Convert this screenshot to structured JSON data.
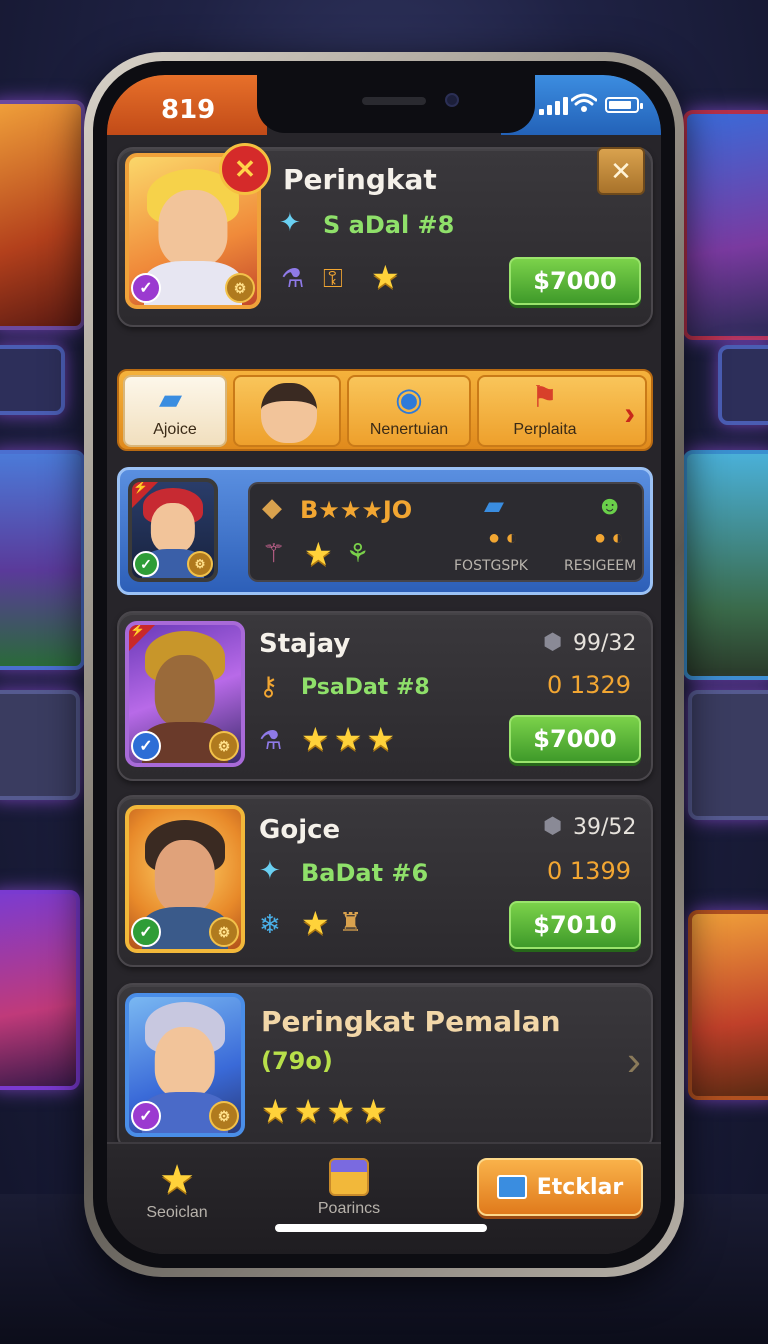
{
  "status_bar": {
    "time": "819"
  },
  "profile": {
    "title": "Peringkat",
    "subtitle": "S aDal #8",
    "price": "$7000"
  },
  "tabs": [
    {
      "label": "Ajoice"
    },
    {
      "label": ""
    },
    {
      "label": "Nenertuian"
    },
    {
      "label": "Perplaita"
    }
  ],
  "highlight": {
    "label": "B★★★JO",
    "stat1": "FOSTGSPK",
    "stat2": "RESIGEEM"
  },
  "players": [
    {
      "name": "Stajay",
      "subtitle": "PsaDat #8",
      "rank": "99/32",
      "score": "0 1329",
      "price": "$7000"
    },
    {
      "name": "Gojce",
      "subtitle": "BaDat #6",
      "rank": "39/52",
      "score": "0 1399",
      "price": "$7010"
    }
  ],
  "leaderboard": {
    "title": "Peringkat Pemalan",
    "count": "(79o)"
  },
  "bottom_nav": {
    "left_label": "Seoiclan",
    "center_label": "Poarincs",
    "action_label": "Etcklar"
  },
  "colors": {
    "accent_orange": "#f2a632",
    "accent_green": "#8fe06a",
    "button_green": "#4caf34",
    "status_blue": "#2f6fd0",
    "status_orange": "#e06a24"
  }
}
